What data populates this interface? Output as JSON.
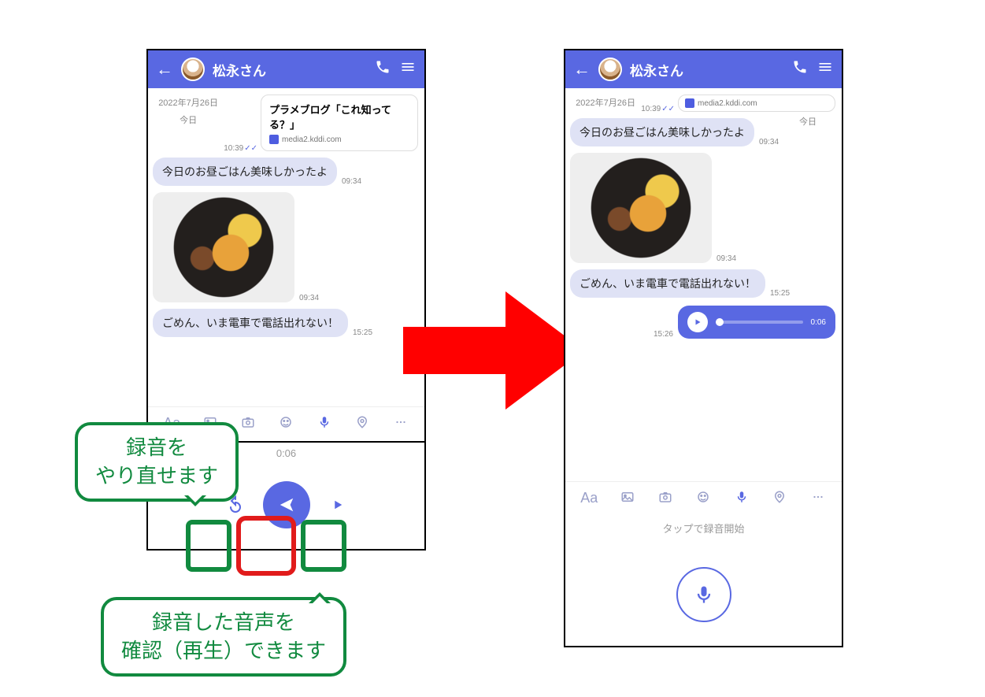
{
  "header": {
    "contact_name": "松永さん"
  },
  "linkcard": {
    "title": "プラメブログ「これ知ってる？」",
    "url_label": "media2.kddi.com",
    "time": "10:39"
  },
  "chat": {
    "date_full": "2022年7月26日",
    "lunch_text": "今日のお昼ごはん美味しかったよ",
    "lunch_time": "09:34",
    "photo_time": "09:34",
    "today_label": "今日",
    "train_text": "ごめん、いま電車で電話出れない！",
    "train_time": "15:25",
    "voice_duration": "0:06",
    "voice_time": "15:26"
  },
  "record_panel": {
    "hint": "タップで録音開始",
    "done_duration": "0:06"
  },
  "callouts": {
    "top_line1": "録音を",
    "top_line2": "やり直せます",
    "bottom_line1": "録音した音声を",
    "bottom_line2": "確認（再生）できます"
  },
  "icons": {
    "back": "back-arrow-icon",
    "phone": "phone-icon",
    "menu": "hamburger-icon",
    "text_aa": "text-format-icon",
    "gallery": "gallery-icon",
    "camera": "camera-icon",
    "emoji": "emoji-icon",
    "mic": "microphone-icon",
    "location": "location-pin-icon",
    "more": "more-dots-icon",
    "play": "play-icon",
    "send": "send-icon",
    "undo": "undo-icon"
  }
}
